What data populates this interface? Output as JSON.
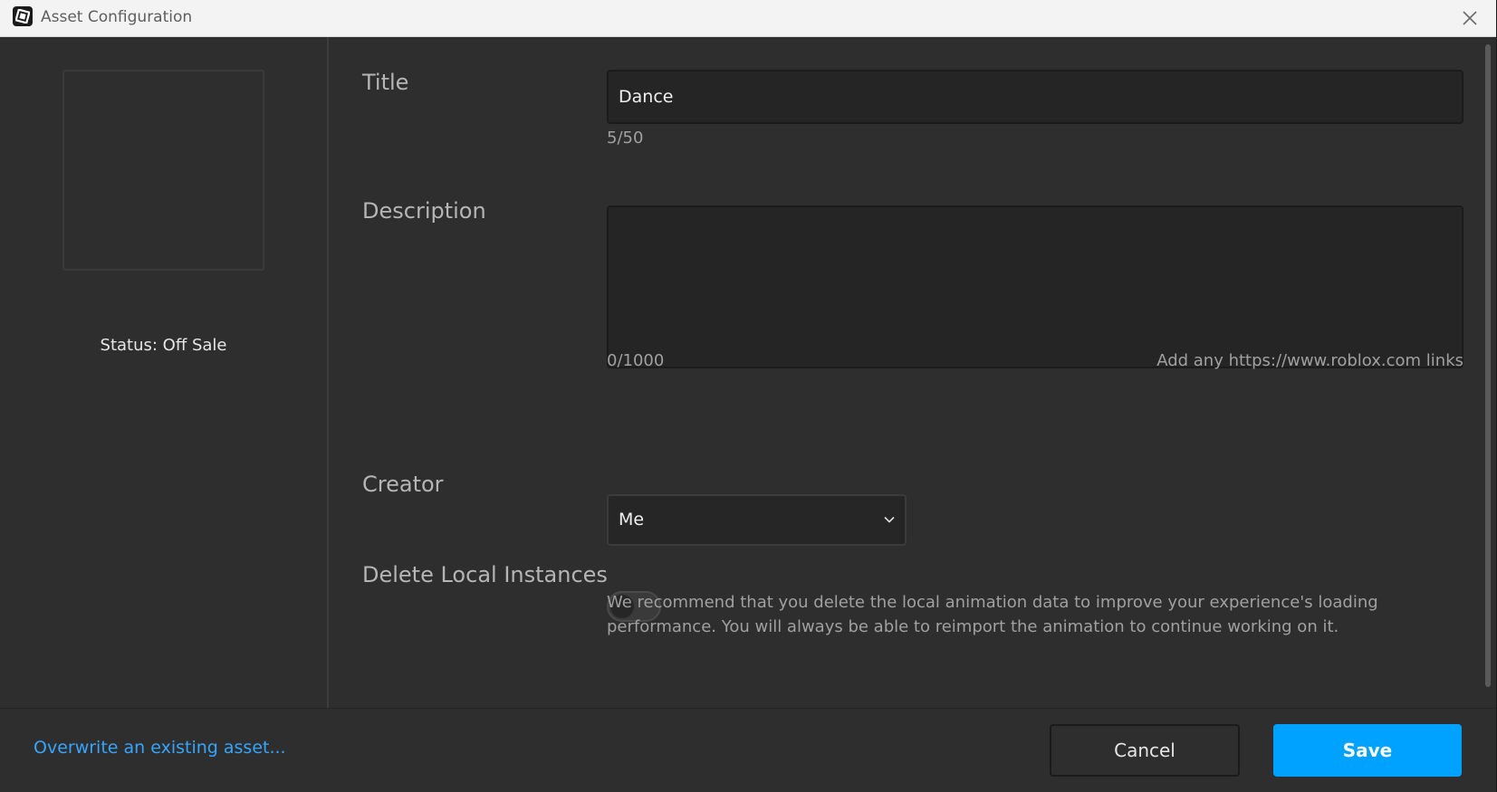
{
  "window": {
    "title": "Asset Configuration",
    "icons": {
      "app": "roblox-studio-logo-icon",
      "close": "close-icon"
    }
  },
  "sidebar": {
    "status": "Status: Off Sale"
  },
  "form": {
    "title": {
      "label": "Title",
      "value": "Dance",
      "counter": "5/50"
    },
    "description": {
      "label": "Description",
      "value": "",
      "counter": "0/1000",
      "hint": "Add any https://www.roblox.com links"
    },
    "creator": {
      "label": "Creator",
      "selected": "Me",
      "icon": "chevron-down-icon"
    },
    "delete_local": {
      "label": "Delete Local Instances",
      "enabled": false,
      "description": "We recommend that you delete the local animation data to improve your experience's loading performance. You will always be able to reimport the animation to continue working on it."
    }
  },
  "footer": {
    "overwrite_link": "Overwrite an existing asset...",
    "cancel_label": "Cancel",
    "save_label": "Save"
  },
  "colors": {
    "accent": "#00a2ff",
    "link": "#35a5ff",
    "background": "#2e2e2e",
    "input_bg": "#252525"
  }
}
